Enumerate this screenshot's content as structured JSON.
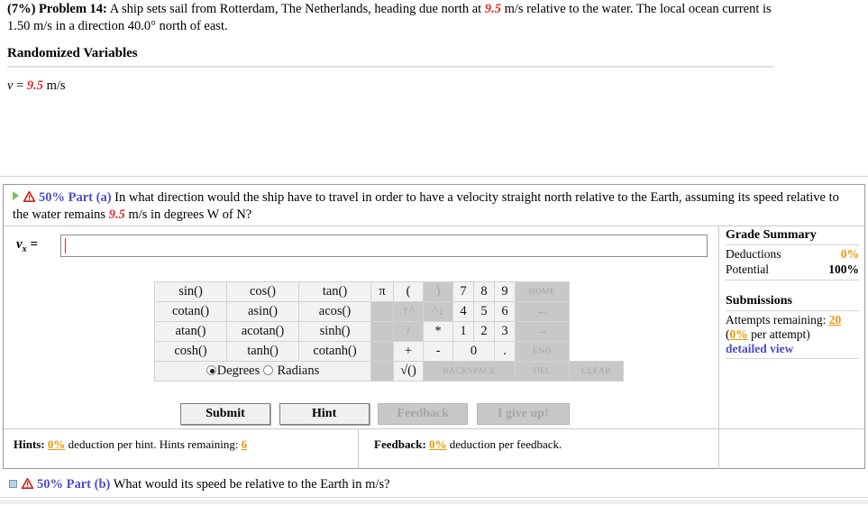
{
  "problem": {
    "weight": "(7%)",
    "label": "Problem 14:",
    "text_before_v": "A ship sets sail from Rotterdam, The Netherlands, heading due north at ",
    "v_value": "9.5",
    "text_after_v": " m/s relative to the water. The local ocean current is 1.50 m/s in a direction 40.0° north of east."
  },
  "randomized": {
    "title": "Randomized Variables",
    "var_name": "v",
    "equals": "= ",
    "value": "9.5",
    "units": " m/s"
  },
  "part_a": {
    "percent": "50%",
    "part_label": "Part",
    "part_id": "(a)",
    "text_before_v": "In what direction would the ship have to travel in order to have a velocity straight north relative to the Earth, assuming its speed relative to the water remains ",
    "v_value": "9.5",
    "text_after_v": " m/s in degrees W of N?",
    "answer_label_base": "v",
    "answer_label_sub": "x",
    "answer_equals": " =",
    "answer_value": "",
    "answer_placeholder": ""
  },
  "calculator": {
    "functions": [
      [
        "sin()",
        "cos()",
        "tan()"
      ],
      [
        "cotan()",
        "asin()",
        "acos()"
      ],
      [
        "atan()",
        "acotan()",
        "sinh()"
      ],
      [
        "cosh()",
        "tanh()",
        "cotanh()"
      ]
    ],
    "keypad": [
      [
        {
          "label": "π",
          "kind": "pi",
          "disabled": false
        },
        {
          "label": "(",
          "kind": "op",
          "disabled": false
        },
        {
          "label": ")",
          "kind": "op",
          "disabled": true
        },
        {
          "label": "7",
          "kind": "dg",
          "disabled": false
        },
        {
          "label": "8",
          "kind": "dg",
          "disabled": false
        },
        {
          "label": "9",
          "kind": "dg",
          "disabled": false
        },
        {
          "label": "HOME",
          "kind": "nav",
          "disabled": true
        }
      ],
      [
        {
          "label": "",
          "kind": "pi",
          "disabled": true
        },
        {
          "label": "↑^",
          "kind": "op",
          "disabled": true
        },
        {
          "label": "^↓",
          "kind": "op",
          "disabled": true
        },
        {
          "label": "4",
          "kind": "dg",
          "disabled": false
        },
        {
          "label": "5",
          "kind": "dg",
          "disabled": false
        },
        {
          "label": "6",
          "kind": "dg",
          "disabled": false
        },
        {
          "label": "←",
          "kind": "nav",
          "disabled": true
        }
      ],
      [
        {
          "label": "",
          "kind": "pi",
          "disabled": true
        },
        {
          "label": "/",
          "kind": "op",
          "disabled": true
        },
        {
          "label": "*",
          "kind": "op",
          "disabled": false
        },
        {
          "label": "1",
          "kind": "dg",
          "disabled": false
        },
        {
          "label": "2",
          "kind": "dg",
          "disabled": false
        },
        {
          "label": "3",
          "kind": "dg",
          "disabled": false
        },
        {
          "label": "→",
          "kind": "nav",
          "disabled": true
        }
      ],
      [
        {
          "label": "",
          "kind": "pi",
          "disabled": true
        },
        {
          "label": "+",
          "kind": "op",
          "disabled": false
        },
        {
          "label": "-",
          "kind": "op",
          "disabled": false
        },
        {
          "label": "0",
          "kind": "dg2",
          "disabled": false
        },
        {
          "label": ".",
          "kind": "dg",
          "disabled": false
        },
        {
          "label": "END",
          "kind": "nav",
          "disabled": true
        }
      ],
      [
        {
          "label": "",
          "kind": "pi",
          "disabled": true
        },
        {
          "label": "√()",
          "kind": "op",
          "disabled": false
        },
        {
          "label": "BACKSPACE",
          "kind": "bksp",
          "disabled": true
        },
        {
          "label": "DEL",
          "kind": "del",
          "disabled": true
        },
        {
          "label": "CLEAR",
          "kind": "nav",
          "disabled": true
        }
      ]
    ],
    "mode_degrees": "Degrees",
    "mode_radians": "Radians",
    "mode_selected": "Degrees"
  },
  "buttons": {
    "submit": "Submit",
    "hint": "Hint",
    "feedback": "Feedback",
    "give_up": "I give up!"
  },
  "hints_bar": {
    "label": "Hints:",
    "deduction": "0%",
    "text_mid": "deduction per hint. Hints remaining:",
    "remaining": "6"
  },
  "feedback_bar": {
    "label": "Feedback:",
    "deduction": "0%",
    "text_mid": "deduction per feedback."
  },
  "grade_summary": {
    "title": "Grade Summary",
    "deductions_label": "Deductions",
    "deductions_value": "0%",
    "potential_label": "Potential",
    "potential_value": "100%",
    "submissions_title": "Submissions",
    "attempts_label": "Attempts remaining:",
    "attempts_value": "20",
    "per_attempt_value": "0%",
    "per_attempt_text": "per attempt)",
    "per_attempt_open": "(",
    "detailed_view": "detailed view"
  },
  "part_b": {
    "percent": "50%",
    "part_label": "Part",
    "part_id": "(b)",
    "text": "What would its speed be relative to the Earth in m/s?"
  },
  "colors": {
    "red_value": "#e8272c",
    "orange": "#f29400",
    "blue": "#4c4ccc",
    "green_play": "#7fbf5a",
    "warn_red": "#cc1f1f",
    "disabled_grey": "#c8c8c8"
  }
}
